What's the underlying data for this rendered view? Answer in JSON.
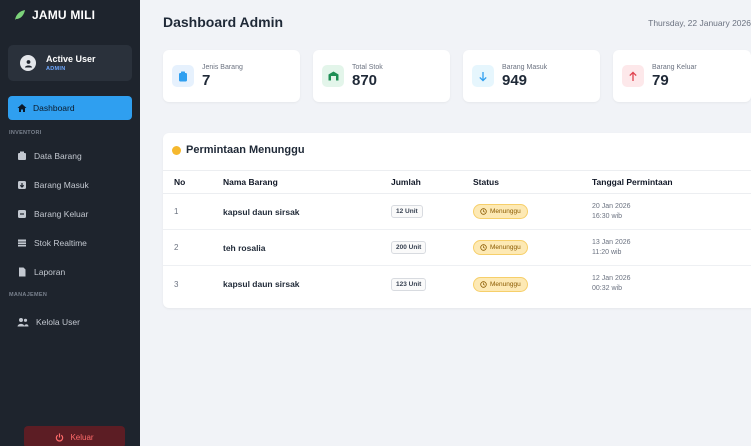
{
  "app": {
    "brand": "JAMU MILI"
  },
  "user": {
    "name": "Active User",
    "role": "ADMIN"
  },
  "sidebar": {
    "active": {
      "label": "Dashboard"
    },
    "inventory_label": "INVENTORI",
    "inventory_items": [
      {
        "label": "Data Barang",
        "icon": "boxes-icon"
      },
      {
        "label": "Barang Masuk",
        "icon": "arrow-in-icon"
      },
      {
        "label": "Barang Keluar",
        "icon": "arrow-out-icon"
      },
      {
        "label": "Stok Realtime",
        "icon": "warehouse-icon"
      },
      {
        "label": "Laporan",
        "icon": "file-icon"
      }
    ],
    "management_label": "MANAJEMEN",
    "management_items": [
      {
        "label": "Kelola User",
        "icon": "users-icon"
      }
    ],
    "logout_label": "Keluar"
  },
  "header": {
    "title": "Dashboard Admin",
    "date": "Thursday, 22 January 2026"
  },
  "stats": [
    {
      "label": "Jenis Barang",
      "value": "7",
      "color": "#2f9ff0",
      "bg": "#e6f1fd"
    },
    {
      "label": "Total Stok",
      "value": "870",
      "color": "#1f8f55",
      "bg": "#e3f5ea"
    },
    {
      "label": "Barang Masuk",
      "value": "949",
      "color": "#2f9ff0",
      "bg": "#e6f6fd"
    },
    {
      "label": "Barang Keluar",
      "value": "79",
      "color": "#e0424f",
      "bg": "#fde8ea"
    }
  ],
  "pending": {
    "title": "Permintaan Menunggu",
    "columns": [
      "No",
      "Nama Barang",
      "Jumlah",
      "Status",
      "Tanggal Permintaan"
    ],
    "rows": [
      {
        "no": "1",
        "nama": "kapsul daun sirsak",
        "jumlah": "12 Unit",
        "status": "Menunggu",
        "tanggal": "20 Jan 2026",
        "jam": "16:30 wib"
      },
      {
        "no": "2",
        "nama": "teh rosalia",
        "jumlah": "200 Unit",
        "status": "Menunggu",
        "tanggal": "13 Jan 2026",
        "jam": "11:20 wib"
      },
      {
        "no": "3",
        "nama": "kapsul daun sirsak",
        "jumlah": "123 Unit",
        "status": "Menunggu",
        "tanggal": "12 Jan 2026",
        "jam": "00:32 wib"
      }
    ]
  }
}
